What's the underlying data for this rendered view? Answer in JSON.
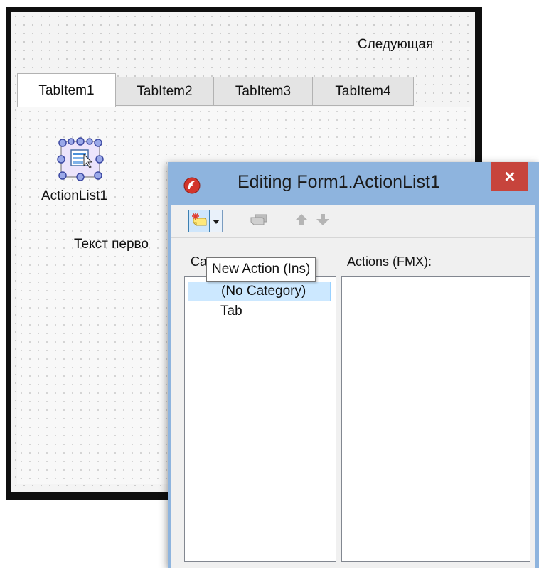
{
  "form": {
    "next_button_label": "Следующая",
    "tabs": [
      {
        "label": "TabItem1",
        "active": true
      },
      {
        "label": "TabItem2",
        "active": false
      },
      {
        "label": "TabItem3",
        "active": false
      },
      {
        "label": "TabItem4",
        "active": false
      }
    ],
    "component_caption": "ActionList1",
    "static_text": "Текст перво"
  },
  "dialog": {
    "title": "Editing Form1.ActionList1",
    "close_glyph": "×",
    "toolbar": {
      "new_action_icon": "new-action-icon",
      "dropdown_icon": "dropdown-arrow-icon",
      "new_standard_action_icon": "new-standard-action-icon",
      "move_up_icon": "arrow-up-icon",
      "move_down_icon": "arrow-down-icon"
    },
    "categories_label_visible": "Ca",
    "actions_label_prefix": "A",
    "actions_label_rest": "ctions (FMX):",
    "categories": [
      {
        "label": "(No Category)",
        "selected": true
      },
      {
        "label": "Tab",
        "selected": false
      }
    ],
    "actions": [],
    "tooltip": "New Action (Ins)"
  },
  "colors": {
    "title_bar": "#8eb4de",
    "close_button": "#c7443c",
    "selection": "#cce8ff",
    "designer_background": "#f4f4f4"
  }
}
